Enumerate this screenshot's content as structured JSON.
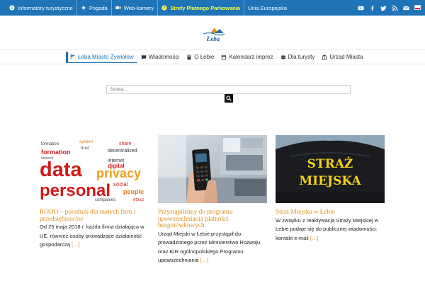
{
  "topbar": {
    "links": [
      {
        "label": "Informatory turystyczne",
        "icon": "info-icon"
      },
      {
        "label": "Pogoda",
        "icon": "sun-icon"
      },
      {
        "label": "Web-kamery",
        "icon": "video-camera-icon"
      },
      {
        "label": "Strefy Płatnego Parkowania",
        "icon": "parking-icon"
      },
      {
        "label": "Unia Europejska",
        "icon": ""
      }
    ],
    "social": [
      "youtube-icon",
      "facebook-icon",
      "twitter-icon",
      "rss-icon",
      "email-icon"
    ],
    "language_flag": "polish-flag-icon",
    "accent_color": "#1f73b7",
    "highlight_color": "#f6ff3c"
  },
  "logo": {
    "text": "Łeba"
  },
  "nav": {
    "items": [
      {
        "label": "Łeba Miasto Żywiołów",
        "icon": "flag-icon",
        "active": true
      },
      {
        "label": "Wiadomości",
        "icon": "chat-icon",
        "active": false
      },
      {
        "label": "O Łebie",
        "icon": "info-book-icon",
        "active": false
      },
      {
        "label": "Kalendarz imprez",
        "icon": "calendar-icon",
        "active": false
      },
      {
        "label": "Dla turysty",
        "icon": "signpost-icon",
        "active": false
      },
      {
        "label": "Urząd Miasta",
        "icon": "building-icon",
        "active": false
      }
    ]
  },
  "search": {
    "placeholder": "Szukaj..."
  },
  "cards": [
    {
      "title": "RODO – poradnik dla małych firm i przedsiębiorców",
      "text": "Od 25 maja 2018 r. każda firma działająca w UE, również osoby prowadzące działalność gospodarczą",
      "more": "[…]",
      "image_words": [
        "data",
        "privacy",
        "personal",
        "formation",
        "network",
        "decentralized",
        "internet",
        "digital",
        "social",
        "people",
        "trust",
        "system",
        "companies",
        "share",
        "ethics"
      ]
    },
    {
      "title": "Przystąpiliśmy do programu upowszechniania płatności bezgotówkowych",
      "text": "Urząd Miejski w Łebie przystąpił do prowadzonego przez Ministerstwo Rozwoju oraz KIR ogólnopolskiego Programu upowszechniania",
      "more": "[…]"
    },
    {
      "title": "Straż Miejska w Łebie",
      "text": "W związku z reaktywacją Straży Miejskiej w Łebie podaje się do publicznej wiadomości: kontakt e-mail",
      "more": "[…]",
      "image_words": [
        "STRAŻ",
        "MIEJSKA"
      ]
    }
  ],
  "colors": {
    "title_orange": "#e0901f",
    "accent_blue": "#1f73b7"
  }
}
